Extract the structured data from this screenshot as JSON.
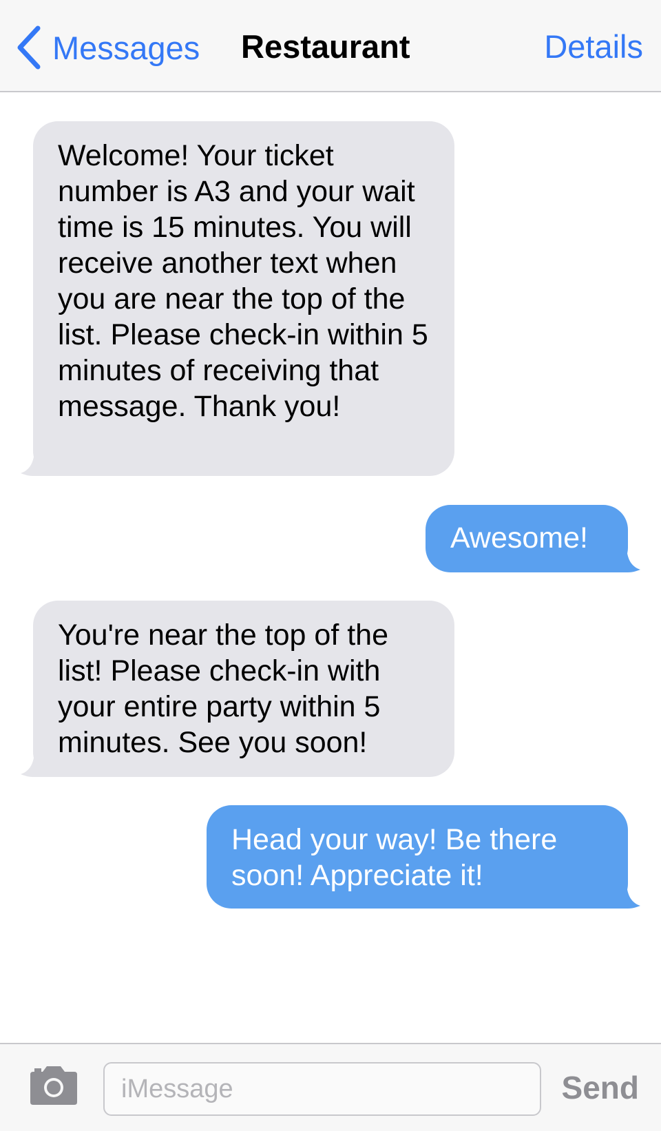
{
  "nav": {
    "back_label": "Messages",
    "title": "Restaurant",
    "details_label": "Details"
  },
  "messages": [
    {
      "direction": "incoming",
      "text": "Welcome! Your ticket number is A3 and your wait time is 15 minutes. You will receive another text when you are near the top of the list. Please check-in within 5 minutes of receiving that message. Thank you!"
    },
    {
      "direction": "outgoing",
      "text": "Awesome!"
    },
    {
      "direction": "incoming",
      "text": "You're near the top of the list! Please check-in with your entire party within 5 minutes. See you soon!"
    },
    {
      "direction": "outgoing",
      "text": "Head your way! Be there soon! Appreciate it!"
    }
  ],
  "compose": {
    "camera_icon": "camera-icon",
    "placeholder": "iMessage",
    "value": "",
    "send_label": "Send"
  },
  "colors": {
    "accent": "#3478f6",
    "incoming_bubble": "#e5e5ea",
    "outgoing_bubble": "#5aa0ef"
  }
}
